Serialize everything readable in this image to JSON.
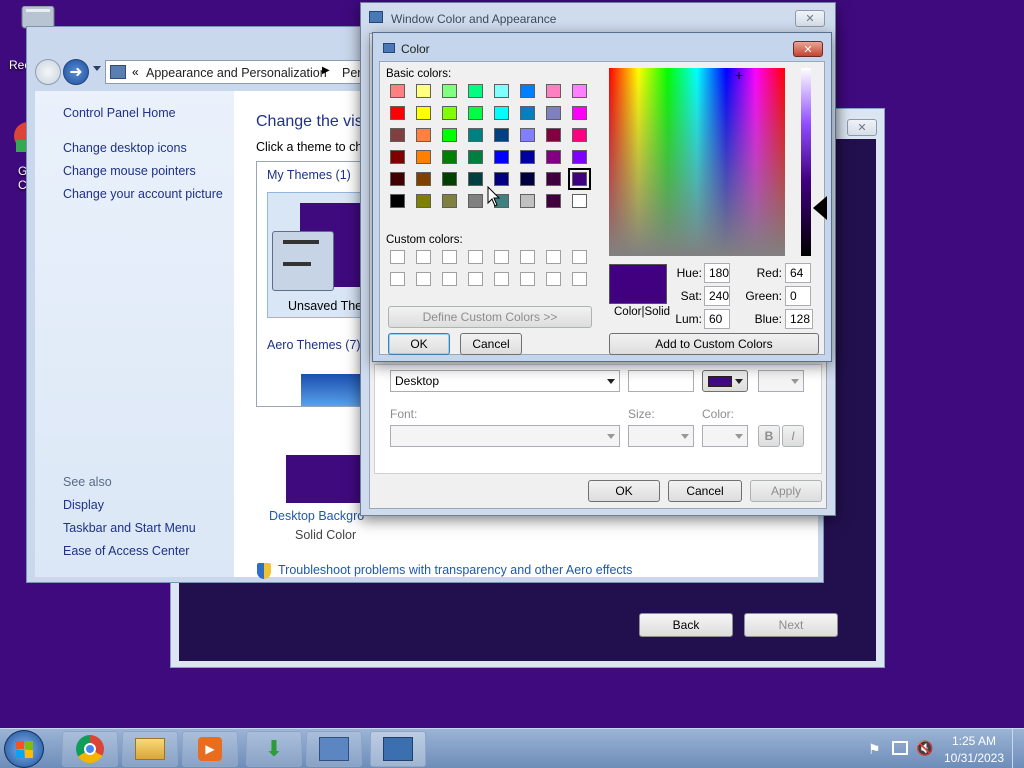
{
  "desktop": {
    "bg": "#3f0a7e",
    "recycle_label": "Rec",
    "chrome_label_1": "G",
    "chrome_label_2": "C"
  },
  "wizard": {
    "back": "Back",
    "next": "Next"
  },
  "control_panel": {
    "breadcrumb_sep": "«",
    "breadcrumb_1": "Appearance and Personalization",
    "breadcrumb_2": "Perso",
    "left_links": [
      "Control Panel Home",
      "Change desktop icons",
      "Change mouse pointers",
      "Change your account picture"
    ],
    "see_also": "See also",
    "see_also_links": [
      "Display",
      "Taskbar and Start Menu",
      "Ease of Access Center"
    ],
    "heading": "Change the visu",
    "subtext": "Click a theme to cha",
    "my_themes": "My Themes (1)",
    "unsaved_theme": "Unsaved The",
    "aero_themes": "Aero Themes (7)",
    "desktop_background": "Desktop Backgro",
    "solid_color": "Solid Color",
    "troubleshoot": "Troubleshoot problems with transparency and other Aero effects"
  },
  "appearance": {
    "title": "Window Color and Appearance",
    "item_value": "Desktop",
    "font_label": "Font:",
    "size_label": "Size:",
    "color_label": "Color:",
    "bold": "B",
    "italic": "I",
    "ok": "OK",
    "cancel": "Cancel",
    "apply": "Apply",
    "swatch": "#3f0a7e"
  },
  "color_dialog": {
    "title": "Color",
    "basic_colors_label": "Basic colors:",
    "custom_colors_label": "Custom colors:",
    "define_custom": "Define Custom Colors >>",
    "ok": "OK",
    "cancel": "Cancel",
    "add_custom": "Add to Custom Colors",
    "color_solid": "Color|Solid",
    "hue_label": "Hue:",
    "hue": "180",
    "sat_label": "Sat:",
    "sat": "240",
    "lum_label": "Lum:",
    "lum": "60",
    "red_label": "Red:",
    "red": "64",
    "green_label": "Green:",
    "green": "0",
    "blue_label": "Blue:",
    "blue": "128",
    "current": "#400080",
    "basic_colors": [
      [
        "#ff8080",
        "#ffff80",
        "#80ff80",
        "#00ff80",
        "#80ffff",
        "#0080ff",
        "#ff80c0",
        "#ff80ff"
      ],
      [
        "#ff0000",
        "#ffff00",
        "#80ff00",
        "#00ff40",
        "#00ffff",
        "#0080c0",
        "#8080c0",
        "#ff00ff"
      ],
      [
        "#804040",
        "#ff8040",
        "#00ff00",
        "#008080",
        "#004080",
        "#8080ff",
        "#800040",
        "#ff0080"
      ],
      [
        "#800000",
        "#ff8000",
        "#008000",
        "#008040",
        "#0000ff",
        "#0000a0",
        "#800080",
        "#8000ff"
      ],
      [
        "#400000",
        "#804000",
        "#004000",
        "#004040",
        "#000080",
        "#000040",
        "#400040",
        "#400080"
      ],
      [
        "#000000",
        "#808000",
        "#808040",
        "#808080",
        "#408080",
        "#c0c0c0",
        "#400040",
        "#ffffff"
      ]
    ],
    "selected_row": 4,
    "selected_col": 7
  },
  "taskbar": {
    "time": "1:25 AM",
    "date": "10/31/2023"
  }
}
